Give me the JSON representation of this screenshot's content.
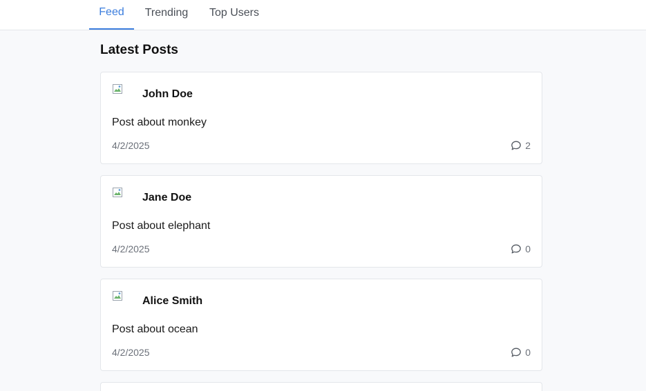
{
  "nav": {
    "tabs": [
      {
        "label": "Feed",
        "active": true
      },
      {
        "label": "Trending",
        "active": false
      },
      {
        "label": "Top Users",
        "active": false
      }
    ],
    "accent_color": "#3b7ddd"
  },
  "main": {
    "title": "Latest Posts",
    "posts": [
      {
        "author": "John Doe",
        "avatar_alt": "John",
        "content": "Post about monkey",
        "date": "4/2/2025",
        "comment_count": "2"
      },
      {
        "author": "Jane Doe",
        "avatar_alt": "Jane",
        "content": "Post about elephant",
        "date": "4/2/2025",
        "comment_count": "0"
      },
      {
        "author": "Alice Smith",
        "avatar_alt": "Alice",
        "content": "Post about ocean",
        "date": "4/2/2025",
        "comment_count": "0"
      }
    ]
  },
  "icons": {
    "comment": "comment-icon",
    "avatar": "broken-image-icon"
  }
}
